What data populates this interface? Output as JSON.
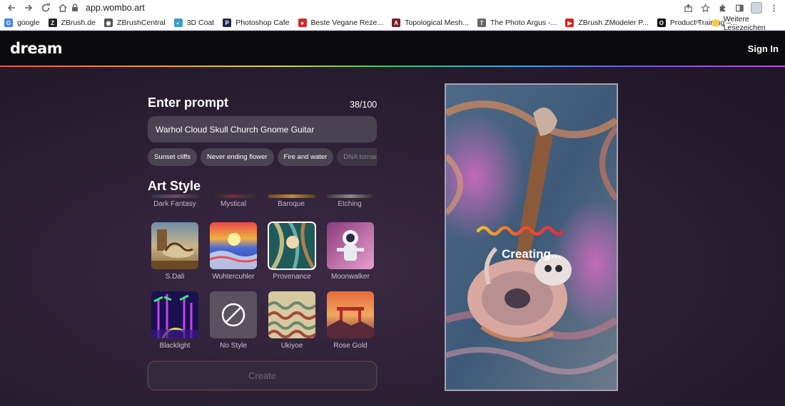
{
  "browser": {
    "url": "app.wombo.art",
    "bookmarks": [
      {
        "label": "google",
        "color": "#4285f4",
        "glyph": "G"
      },
      {
        "label": "ZBrush.de",
        "color": "#222222",
        "glyph": "Z"
      },
      {
        "label": "ZBrushCentral",
        "color": "#555555",
        "glyph": "◉"
      },
      {
        "label": "3D Coat",
        "color": "#3a9bc6",
        "glyph": "◐"
      },
      {
        "label": "Photoshop Cafe",
        "color": "#1e2a4a",
        "glyph": "P"
      },
      {
        "label": "Beste Vegane Reze...",
        "color": "#d9262e",
        "glyph": "●"
      },
      {
        "label": "Topological Mesh...",
        "color": "#7a1f2b",
        "glyph": "A"
      },
      {
        "label": "The Photo Argus -...",
        "color": "#666666",
        "glyph": "T"
      },
      {
        "label": "ZBrush ZModeler P...",
        "color": "#e02020",
        "glyph": "▶"
      },
      {
        "label": "Product Training –...",
        "color": "#111111",
        "glyph": "O"
      }
    ],
    "more": "»",
    "other_bookmarks": "Weitere Lesezeichen"
  },
  "app": {
    "logo": "dream",
    "sign_in": "Sign In"
  },
  "prompt": {
    "title": "Enter prompt",
    "counter": "38/100",
    "value": "Warhol Cloud Skull Church Gnome Guitar",
    "suggestions": [
      "Sunset cliffs",
      "Never ending flower",
      "Fire and water",
      "DNA tornado"
    ]
  },
  "art_style": {
    "title": "Art Style",
    "top_row": [
      "Dark Fantasy",
      "Mystical",
      "Baroque",
      "Etching"
    ],
    "row1": [
      "S.Dali",
      "Wuhtercuhler",
      "Provenance",
      "Moonwalker"
    ],
    "row2": [
      "Blacklight",
      "No Style",
      "Ukiyoe",
      "Rose Gold"
    ],
    "selected": "Provenance"
  },
  "create_label": "Create",
  "status": "Creating..."
}
